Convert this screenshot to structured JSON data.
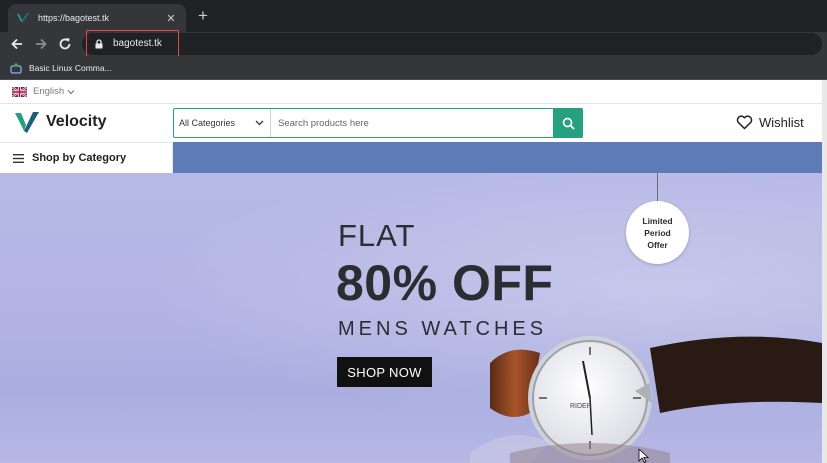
{
  "browser": {
    "tab_title": "https://bagotest.tk",
    "url": "bagotest.tk",
    "bookmark": "Basic Linux Comma...",
    "accent_highlight": "#e04a44"
  },
  "site": {
    "language": "English",
    "brand": "Velocity",
    "search": {
      "category": "All Categories",
      "placeholder": "Search products here"
    },
    "wishlist": "Wishlist",
    "shop_by_category": "Shop by Category",
    "brand_color": "#26a17f",
    "nav_bar_color": "#5d7bb6"
  },
  "hero": {
    "line1": "FLAT",
    "line2": "80% OFF",
    "line3": "MENS WATCHES",
    "cta": "SHOP NOW",
    "badge": [
      "Limited",
      "Period",
      "Offer"
    ],
    "watch_brand": "RIDER"
  }
}
